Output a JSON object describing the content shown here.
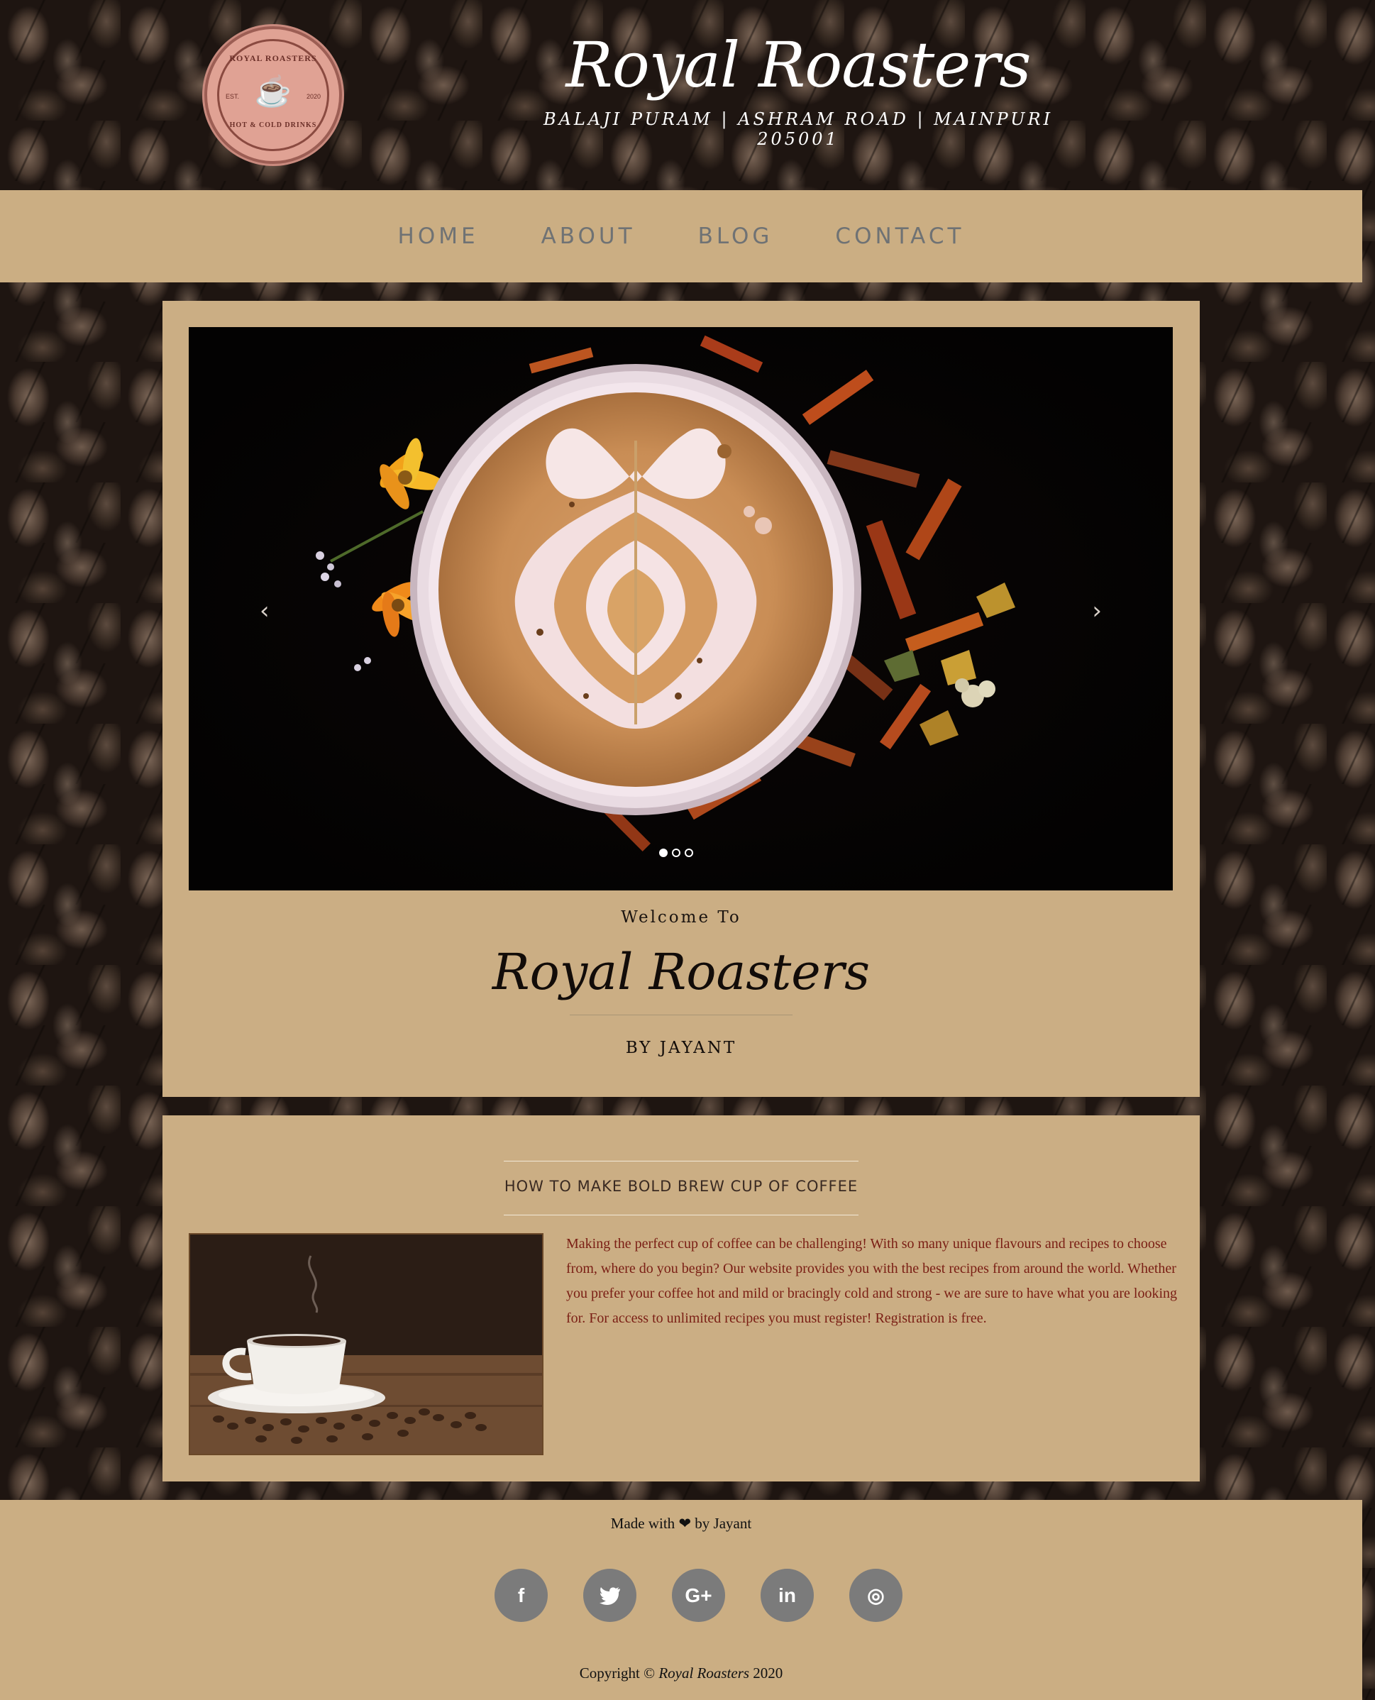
{
  "header": {
    "logo": {
      "top_text": "ROYAL ROASTERS",
      "est": "EST.",
      "year": "2020",
      "bottom_text": "HOT & COLD DRINKS",
      "icon": "coffee-cup-icon"
    },
    "title": "Royal Roasters",
    "address": "BALAJI PURAM | ASHRAM ROAD | MAINPURI 205001"
  },
  "nav": {
    "items": [
      {
        "label": "HOME"
      },
      {
        "label": "ABOUT"
      },
      {
        "label": "BLOG"
      },
      {
        "label": "CONTACT"
      }
    ]
  },
  "hero": {
    "prev_arrow": "‹",
    "next_arrow": "›",
    "slide_count": 3,
    "active_slide": 1,
    "welcome_small": "Welcome To",
    "welcome_title": "Royal Roasters",
    "welcome_by": "BY JAYANT"
  },
  "post": {
    "title": "HOW TO MAKE BOLD BREW CUP OF COFFEE",
    "body": "Making the perfect cup of coffee can be challenging! With so many unique flavours and recipes to choose from, where do you begin? Our website provides you with the best recipes from around the world. Whether you prefer your coffee hot and mild or bracingly cold and strong - we are sure to have what you are looking for. For access to unlimited recipes you must register! Registration is free."
  },
  "footer": {
    "made_prefix": "Made with",
    "made_suffix": "by Jayant",
    "heart_icon": "heart-icon",
    "socials": [
      {
        "icon": "facebook-icon",
        "glyph": "f"
      },
      {
        "icon": "twitter-icon",
        "glyph": "t"
      },
      {
        "icon": "google-plus-icon",
        "glyph": "G+"
      },
      {
        "icon": "linkedin-icon",
        "glyph": "in"
      },
      {
        "icon": "dribbble-icon",
        "glyph": "◎"
      }
    ],
    "copyright_prefix": "Copyright ©",
    "copyright_name": "Royal Roasters",
    "copyright_year": "2020"
  },
  "colors": {
    "panel": "#cbae84",
    "nav_text": "#6f7274",
    "body_text": "#7a1e14",
    "social_bg": "#7b7b7b"
  }
}
